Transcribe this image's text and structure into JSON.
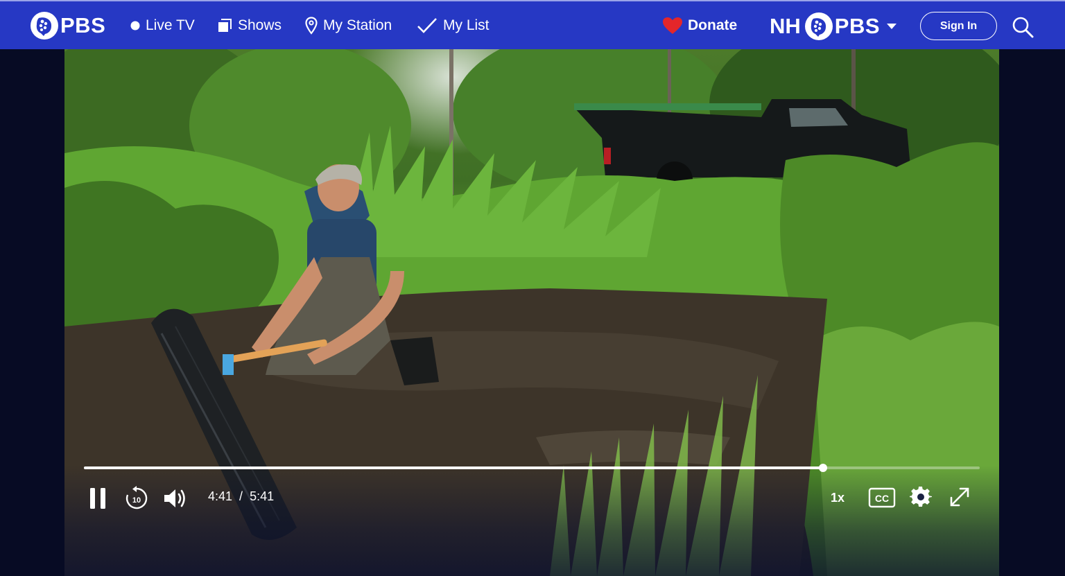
{
  "header": {
    "brand": "PBS",
    "nav": [
      {
        "label": "Live TV",
        "icon": "live-dot-icon"
      },
      {
        "label": "Shows",
        "icon": "shows-icon"
      },
      {
        "label": "My Station",
        "icon": "location-pin-icon"
      },
      {
        "label": "My List",
        "icon": "checkmark-icon"
      }
    ],
    "donate_label": "Donate",
    "station": {
      "prefix": "NH",
      "brand": "PBS"
    },
    "signin_label": "Sign In",
    "colors": {
      "bar": "#2638c4",
      "heart": "#e4262a"
    }
  },
  "player": {
    "progress": {
      "elapsed": "4:41",
      "separator": "/",
      "duration": "5:41",
      "fraction": 0.825
    },
    "speed_label": "1x",
    "cc_label": "CC",
    "rewind_seconds": "10"
  }
}
